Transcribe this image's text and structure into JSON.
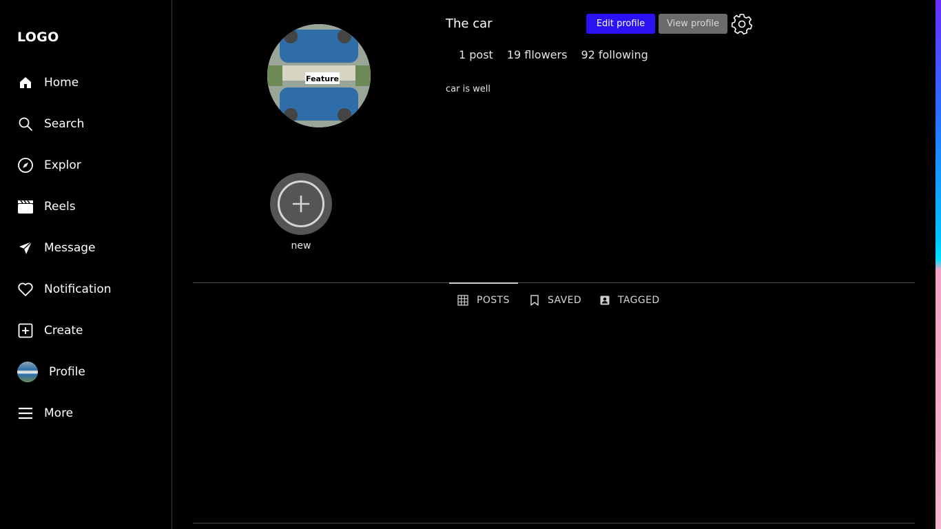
{
  "sidebar": {
    "logo": "LOGO",
    "items": [
      {
        "label": "Home",
        "icon": "home-icon"
      },
      {
        "label": "Search",
        "icon": "search-icon"
      },
      {
        "label": "Explor",
        "icon": "compass-icon"
      },
      {
        "label": "Reels",
        "icon": "clapperboard-icon"
      },
      {
        "label": "Message",
        "icon": "send-icon"
      },
      {
        "label": "Notification",
        "icon": "heart-icon"
      },
      {
        "label": "Create",
        "icon": "plus-square-icon"
      },
      {
        "label": "Profile",
        "icon": "avatar"
      },
      {
        "label": "More",
        "icon": "menu-icon"
      }
    ]
  },
  "profile": {
    "username": "The car",
    "edit_button": "Edit profile",
    "view_button": "View profile",
    "stats": {
      "posts": "1 post",
      "followers": "19 fllowers",
      "following": "92 following"
    },
    "bio": "car is well",
    "avatar_text": "Feature"
  },
  "highlights": {
    "new_label": "new"
  },
  "tabs": [
    {
      "label": "POSTS",
      "icon": "grid-icon",
      "active": true
    },
    {
      "label": "SAVED",
      "icon": "bookmark-icon",
      "active": false
    },
    {
      "label": "TAGGED",
      "icon": "tag-person-icon",
      "active": false
    }
  ],
  "colors": {
    "accent": "#2b12f2",
    "secondary_button": "#6b6b6b",
    "background": "#000000"
  }
}
